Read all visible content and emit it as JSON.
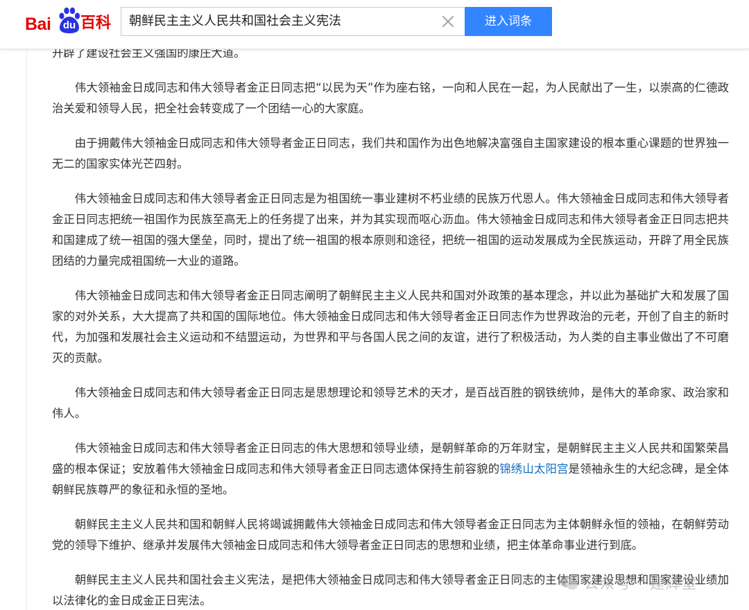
{
  "header": {
    "logo": {
      "part1": "Bai",
      "part2": "du",
      "part3": "百科"
    },
    "search": {
      "value": "朝鲜民主主义人民共和国社会主义宪法",
      "placeholder": ""
    },
    "button_label": "进入词条"
  },
  "colors": {
    "brand_red": "#e10602",
    "brand_blue": "#2932e1",
    "button_blue": "#3385ff",
    "link_blue": "#136ec2"
  },
  "icons": {
    "clear": "close-icon",
    "paw": "baidu-paw-icon",
    "watermark": "wechat-icon"
  },
  "article": {
    "top_fragment": "开辟了建设社会主义强国的康庄大道。",
    "paragraphs": [
      "伟大领袖金日成同志和伟大领导者金正日同志把“以民为天”作为座右铭，一向和人民在一起，为人民献出了一生，以崇高的仁德政治关爱和领导人民，把全社会转变成了一个团结一心的大家庭。",
      "由于拥戴伟大领袖金日成同志和伟大领导者金正日同志，我们共和国作为出色地解决富强自主国家建设的根本重心课题的世界独一无二的国家实体光芒四射。",
      "伟大领袖金日成同志和伟大领导者金正日同志是为祖国统一事业建树不朽业绩的民族万代恩人。伟大领袖金日成同志和伟大领导者金正日同志把统一祖国作为民族至高无上的任务提了出来，并为其实现而呕心沥血。伟大领袖金日成同志和伟大领导者金正日同志把共和国建成了统一祖国的强大堡垒，同时，提出了统一祖国的根本原则和途径，把统一祖国的运动发展成为全民族运动，开辟了用全民族团结的力量完成祖国统一大业的道路。",
      "伟大领袖金日成同志和伟大领导者金正日同志阐明了朝鲜民主主义人民共和国对外政策的基本理念，并以此为基础扩大和发展了国家的对外关系，大大提高了共和国的国际地位。伟大领袖金日成同志和伟大领导者金正日同志作为世界政治的元老，开创了自主的新时代，为加强和发展社会主义运动和不结盟运动，为世界和平与各国人民之间的友谊，进行了积极活动，为人类的自主事业做出了不可磨灭的贡献。",
      "伟大领袖金日成同志和伟大领导者金正日同志是思想理论和领导艺术的天才，是百战百胜的钢铁统帅，是伟大的革命家、政治家和伟人。"
    ],
    "link_paragraph": {
      "before": "伟大领袖金日成同志和伟大领导者金正日同志的伟大思想和领导业绩，是朝鲜革命的万年财宝，是朝鲜民主主义人民共和国繁荣昌盛的根本保证；安放着伟大领袖金日成同志和伟大领导者金正日同志遗体保持生前容貌的",
      "link": "锦绣山太阳宫",
      "after": "是领袖永生的大纪念碑，是全体朝鲜民族尊严的象征和永恒的圣地。"
    },
    "paragraphs_after": [
      "朝鲜民主主义人民共和国和朝鲜人民将竭诚拥戴伟大领袖金日成同志和伟大领导者金正日同志为主体朝鲜永恒的领袖，在朝鲜劳动党的领导下维护、继承并发展伟大领袖金日成同志和伟大领导者金正日同志的思想和业绩，把主体革命事业进行到底。",
      "朝鲜民主主义人民共和国社会主义宪法，是把伟大领袖金日成同志和伟大领导者金正日同志的主体国家建设思想和国家建设业绩加以法律化的金日成金正日宪法。"
    ]
  },
  "watermark": {
    "text": "公众号 · 建辉堂"
  }
}
